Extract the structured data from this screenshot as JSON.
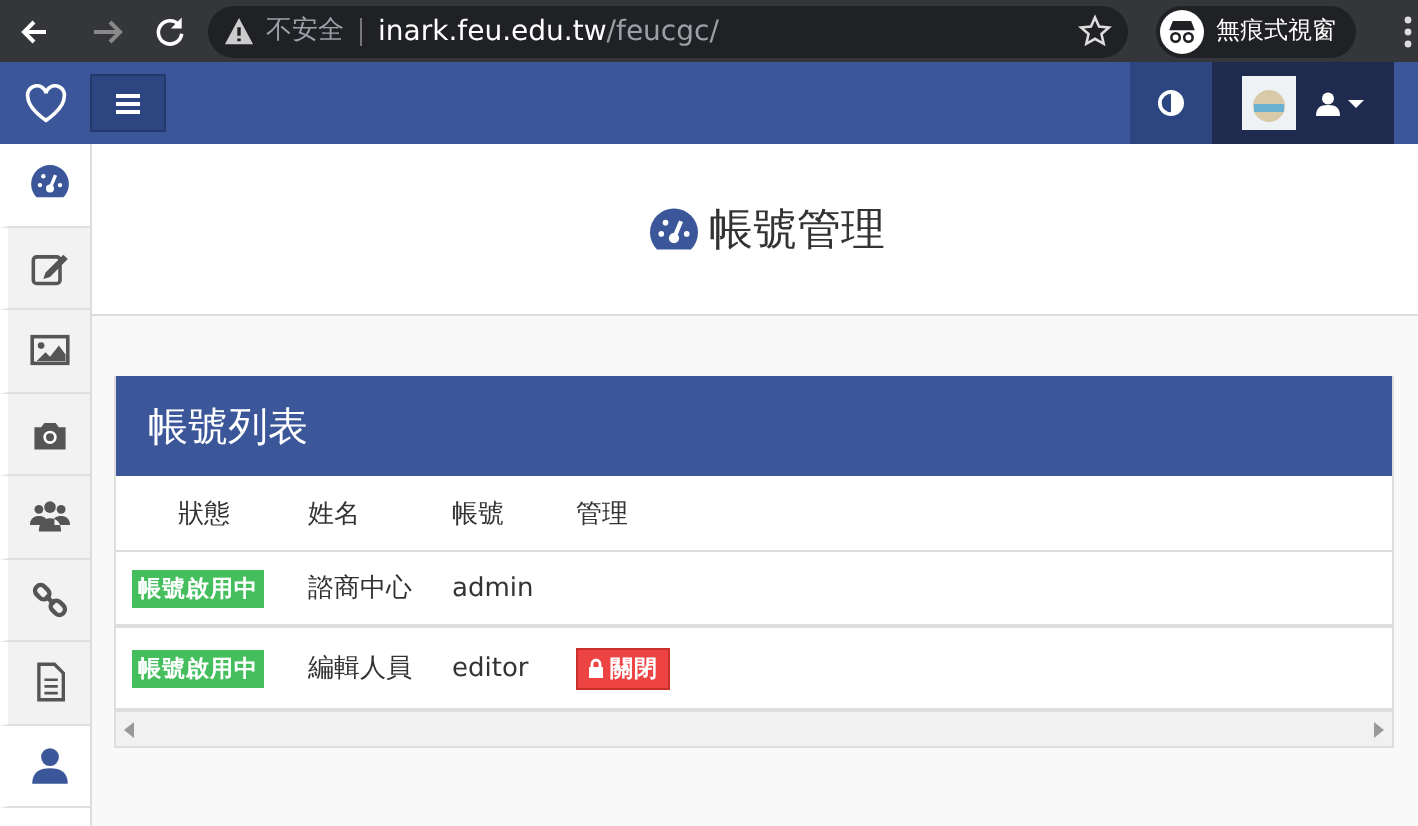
{
  "browser": {
    "security": "不安全",
    "url_host": "inark.feu.edu.tw",
    "url_path": "/feucgc/",
    "profile": "無痕式視窗"
  },
  "sidebar": {
    "items": [
      {
        "selected": true
      },
      {
        "selected": false
      },
      {
        "selected": false
      },
      {
        "selected": false
      },
      {
        "selected": false
      },
      {
        "selected": false
      },
      {
        "selected": false
      },
      {
        "selected": true
      }
    ]
  },
  "page": {
    "title": "帳號管理"
  },
  "panel": {
    "title": "帳號列表",
    "columns": [
      "狀態",
      "姓名",
      "帳號",
      "管理"
    ],
    "rows": [
      {
        "status": "帳號啟用中",
        "name": "諮商中心",
        "account": "admin"
      },
      {
        "status": "帳號啟用中",
        "name": "編輯人員",
        "account": "editor",
        "action": "關閉"
      }
    ]
  }
}
